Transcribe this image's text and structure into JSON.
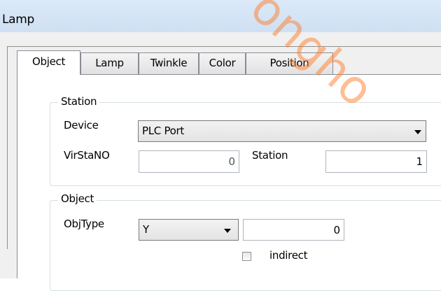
{
  "window": {
    "title": "Lamp"
  },
  "tabs": [
    {
      "label": "Object",
      "active": true
    },
    {
      "label": "Lamp",
      "active": false
    },
    {
      "label": "Twinkle",
      "active": false
    },
    {
      "label": "Color",
      "active": false
    },
    {
      "label": "Position",
      "active": false
    }
  ],
  "station_group": {
    "title": "Station",
    "device_label": "Device",
    "device_value": "PLC Port",
    "virstano_label": "VirStaNO",
    "virstano_value": "0",
    "station_label": "Station",
    "station_value": "1"
  },
  "object_group": {
    "title": "Object",
    "objtype_label": "ObjType",
    "objtype_value": "Y",
    "address_value": "0",
    "indirect_label": "indirect",
    "indirect_checked": false
  },
  "watermark": {
    "text": "ongho"
  },
  "colors": {
    "title_bar": "#dbe9f8",
    "dialog_bg": "#f0f0f0",
    "watermark": "#ff7f2a"
  }
}
